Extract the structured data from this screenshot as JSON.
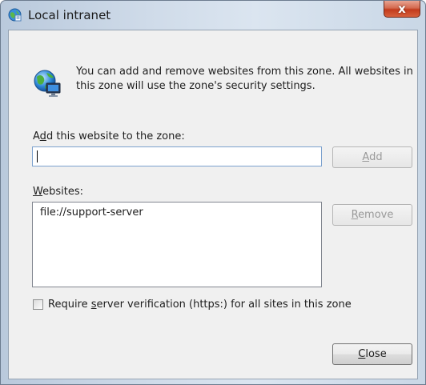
{
  "window": {
    "title": "Local intranet",
    "close_glyph": "x"
  },
  "description": "You can add and remove websites from this zone. All websites in this zone will use the zone's security settings.",
  "add_section": {
    "label_pre": "A",
    "label_mnemonic": "d",
    "label_post": "d this website to the zone:",
    "input_value": "",
    "add_button": {
      "mnemonic": "A",
      "rest": "dd",
      "enabled": false
    }
  },
  "websites_section": {
    "label_mnemonic": "W",
    "label_rest": "ebsites:",
    "items": [
      "file://support-server"
    ],
    "remove_button": {
      "mnemonic": "R",
      "rest": "emove",
      "enabled": false
    }
  },
  "require_verification": {
    "checked": false,
    "label_pre": "Require ",
    "label_mnemonic": "s",
    "label_post": "erver verification (https:) for all sites in this zone"
  },
  "close_button": {
    "mnemonic": "C",
    "rest": "lose",
    "enabled": true
  },
  "icons": {
    "title": "internet-options-icon",
    "zone": "globe-monitor-icon"
  }
}
